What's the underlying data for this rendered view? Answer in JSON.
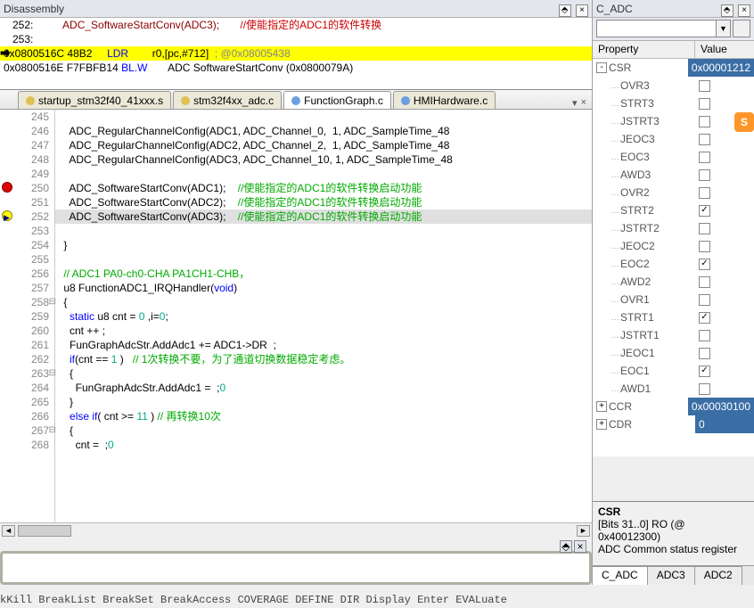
{
  "disasm": {
    "title": "Disassembly",
    "lines": [
      {
        "ln": "   252:",
        "code": "          ADC_SoftwareStartConv(ADC3);",
        "cm": "       //使能指定的ADC1的软件转换"
      },
      {
        "ln": "   253:"
      },
      {
        "addr": "0x0800516C",
        "op1": "48B2",
        "mn": "LDR",
        "args": "r0,[pc,#712]",
        "cm": "; @0x08005438",
        "hl": true
      },
      {
        "addr": "0x0800516E",
        "op1": "F7FBFB14",
        "mn": "BL.W",
        "args": "ADC SoftwareStartConv (0x0800079A)"
      }
    ]
  },
  "tabs": [
    {
      "name": "startup_stm32f40_41xxx.s",
      "color": "#e0c050"
    },
    {
      "name": "stm32f4xx_adc.c",
      "color": "#e0c050"
    },
    {
      "name": "FunctionGraph.c",
      "color": "#6aa0e0",
      "active": true
    },
    {
      "name": "HMIHardware.c",
      "color": "#6aa0e0"
    }
  ],
  "code": [
    {
      "n": 245,
      "t": ""
    },
    {
      "n": 246,
      "t": "   ADC_RegularChannelConfig(ADC1, ADC_Channel_0,  1, ADC_SampleTime_48"
    },
    {
      "n": 247,
      "t": "   ADC_RegularChannelConfig(ADC2, ADC_Channel_2,  1, ADC_SampleTime_48"
    },
    {
      "n": 248,
      "t": "   ADC_RegularChannelConfig(ADC3, ADC_Channel_10, 1, ADC_SampleTime_48"
    },
    {
      "n": 249,
      "t": ""
    },
    {
      "n": 250,
      "bp": true,
      "t": "   ADC_SoftwareStartConv(ADC1);",
      "cm": "    //使能指定的ADC1的软件转换启动功能"
    },
    {
      "n": 251,
      "t": "   ADC_SoftwareStartConv(ADC2);",
      "cm": "    //使能指定的ADC1的软件转换启动功能"
    },
    {
      "n": 252,
      "cur": true,
      "sel": true,
      "t": "   ADC_SoftwareStartConv(ADC3);",
      "cm": "    //使能指定的ADC1的软件转换启动功能"
    },
    {
      "n": 253,
      "t": ""
    },
    {
      "n": 254,
      "t": " }"
    },
    {
      "n": 255,
      "t": ""
    },
    {
      "n": 256,
      "cm": " // ADC1 PA0-ch0-CHA PA1CH1-CHB，"
    },
    {
      "n": 257,
      "t": " u8 FunctionADC1_IRQHandler(",
      "kw": "void",
      "t2": ")"
    },
    {
      "n": 258,
      "fold": "⊟",
      "t": " {"
    },
    {
      "n": 259,
      "t": "   ",
      "kw": "static",
      "t2": " u8 cnt = ",
      "num": "0",
      "t3": " ,i=",
      "num2": "0",
      "t4": ";"
    },
    {
      "n": 260,
      "t": "   cnt ++ ;"
    },
    {
      "n": 261,
      "t": "   FunGraphAdcStr.AddAdc1 += ADC1->DR  ;"
    },
    {
      "n": 262,
      "t": "   ",
      "kw": "if",
      "t2": "(cnt == ",
      "num": "1",
      "t3": " )",
      "cm": "   // 1次转换不要，为了通道切换数据稳定考虑。"
    },
    {
      "n": 263,
      "fold": "⊟",
      "t": "   {"
    },
    {
      "n": 264,
      "t": "     FunGraphAdcStr.AddAdc1 = ",
      "num": "0",
      "t2": " ;"
    },
    {
      "n": 265,
      "t": "   }"
    },
    {
      "n": 266,
      "t": "   ",
      "kw": "else if",
      "t2": "( cnt >= ",
      "num": "11",
      "t3": " )",
      "cm": " // 再转换10次"
    },
    {
      "n": 267,
      "fold": "⊟",
      "t": "   {"
    },
    {
      "n": 268,
      "t": "     cnt = ",
      "num": "0",
      "t2": " ;"
    }
  ],
  "cmdline": "kKill BreakList BreakSet BreakAccess COVERAGE DEFINE DIR Display Enter EVALuate",
  "cadc": {
    "title": "C_ADC",
    "head_k": "Property",
    "head_v": "Value",
    "rows": [
      {
        "exp": "-",
        "k": "CSR",
        "v": "0x00001212",
        "sel": true
      },
      {
        "ind": 1,
        "k": "OVR3",
        "chk": 0
      },
      {
        "ind": 1,
        "k": "STRT3",
        "chk": 0
      },
      {
        "ind": 1,
        "k": "JSTRT3",
        "chk": 0
      },
      {
        "ind": 1,
        "k": "JEOC3",
        "chk": 0
      },
      {
        "ind": 1,
        "k": "EOC3",
        "chk": 0
      },
      {
        "ind": 1,
        "k": "AWD3",
        "chk": 0
      },
      {
        "ind": 1,
        "k": "OVR2",
        "chk": 0
      },
      {
        "ind": 1,
        "k": "STRT2",
        "chk": 1
      },
      {
        "ind": 1,
        "k": "JSTRT2",
        "chk": 0
      },
      {
        "ind": 1,
        "k": "JEOC2",
        "chk": 0
      },
      {
        "ind": 1,
        "k": "EOC2",
        "chk": 1
      },
      {
        "ind": 1,
        "k": "AWD2",
        "chk": 0
      },
      {
        "ind": 1,
        "k": "OVR1",
        "chk": 0
      },
      {
        "ind": 1,
        "k": "STRT1",
        "chk": 1
      },
      {
        "ind": 1,
        "k": "JSTRT1",
        "chk": 0
      },
      {
        "ind": 1,
        "k": "JEOC1",
        "chk": 0
      },
      {
        "ind": 1,
        "k": "EOC1",
        "chk": 1
      },
      {
        "ind": 1,
        "k": "AWD1",
        "chk": 0
      },
      {
        "exp": "+",
        "k": "CCR",
        "v": "0x00030100",
        "sel": true
      },
      {
        "exp": "+",
        "k": "CDR",
        "v": "0",
        "sel": true
      }
    ],
    "desc_t": "CSR",
    "desc_1": "[Bits 31..0] RO (@ 0x40012300)",
    "desc_2": "ADC Common status register",
    "btabs": [
      "C_ADC",
      "ADC3",
      "ADC2"
    ]
  }
}
